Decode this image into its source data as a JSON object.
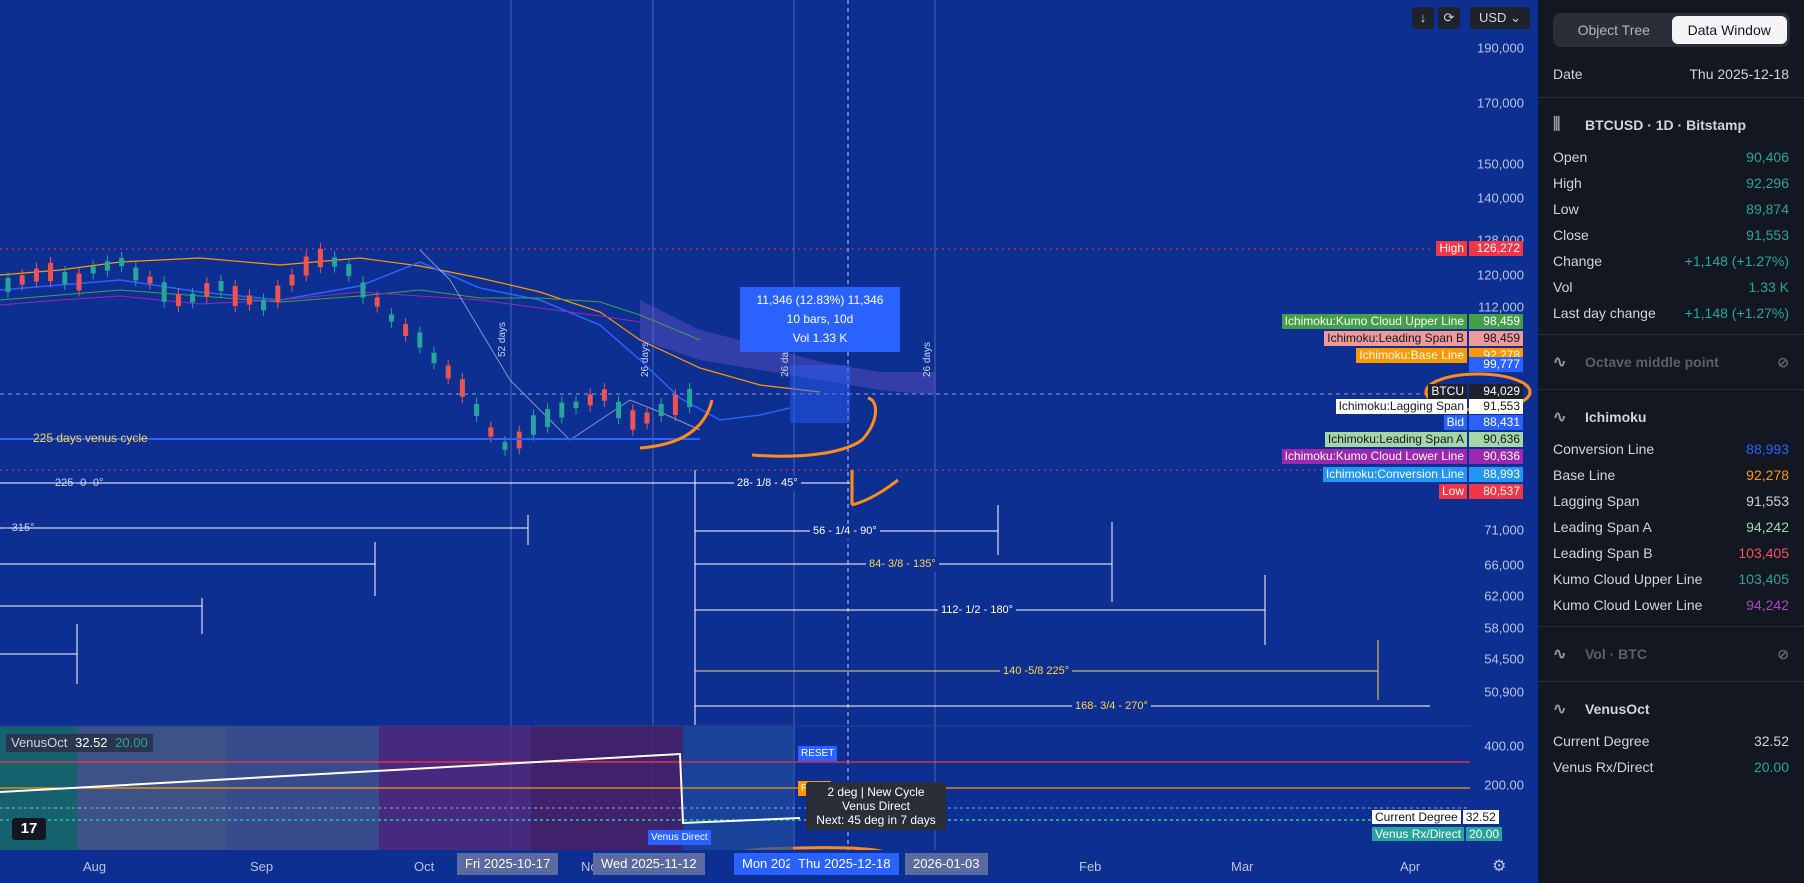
{
  "toolbar": {
    "download_icon": "download-icon",
    "refresh_icon": "refresh-icon",
    "currency": "USD"
  },
  "price_axis": [
    "190,000",
    "170,000",
    "150,000",
    "140,000",
    "128,000",
    "120,000",
    "112,000",
    "71,000",
    "66,000",
    "62,000",
    "58,000",
    "54,500",
    "50,900"
  ],
  "osc_axis": [
    "400.00",
    "200.00"
  ],
  "time_axis": {
    "labels": [
      "Aug",
      "Sep",
      "Oct",
      "No",
      "Feb",
      "Mar",
      "Apr"
    ],
    "highlighted": [
      "Fri 2025-10-17",
      "Wed 2025-11-12",
      "Mon 202",
      "Thu 2025-12-18",
      "2026-01-03"
    ]
  },
  "price_tags": [
    {
      "label": "High",
      "value": "126,272",
      "color": "#f23645"
    },
    {
      "label": "Ichimoku:Kumo Cloud Upper Line",
      "value": "98,459",
      "color": "#43a047"
    },
    {
      "label": "Ichimoku:Leading Span B",
      "value": "98,459",
      "color": "#ef9a9a"
    },
    {
      "label": "Ichimoku:Base Line",
      "value": "92,278",
      "color": "#ff9800"
    },
    {
      "label": "",
      "value": "99,777",
      "color": "#2962ff"
    },
    {
      "label": "BTCU",
      "value": "94,029",
      "color": "#1e222d"
    },
    {
      "label": "Ichimoku:Lagging Span",
      "value": "91,553",
      "color": "#ffffff"
    },
    {
      "label": "Bid",
      "value": "88,431",
      "color": "#2962ff"
    },
    {
      "label": "Ichimoku:Leading Span A",
      "value": "90,636",
      "color": "#a5d6a7"
    },
    {
      "label": "Ichimoku:Kumo Cloud Lower Line",
      "value": "90,636",
      "color": "#9c27b0"
    },
    {
      "label": "Ichimoku:Conversion Line",
      "value": "88,993",
      "color": "#2196f3"
    },
    {
      "label": "Low",
      "value": "80,537",
      "color": "#f23645"
    }
  ],
  "measure_box": {
    "line1": "11,346 (12.83%) 11,346",
    "line2": "10 bars, 10d",
    "line3": "Vol 1.33 K"
  },
  "annotations": {
    "venus_cycle": "225 days venus cycle",
    "venus_arrow": "225- 0- 0°",
    "left_arrow": "- 315°",
    "arrows": [
      "28- 1/8 - 45°",
      "56 - 1/4 - 90°",
      "84- 3/8 - 135°",
      "112- 1/2 - 180°",
      "140 -5/8 225°",
      "168- 3/4 - 270°"
    ],
    "vlines": [
      "52 days",
      "26 days",
      "26 da",
      "26 days"
    ]
  },
  "oscillator": {
    "name": "VenusOct",
    "value1": "32.52",
    "value2": "20.00",
    "reset": "RESET",
    "peak": "PEAK",
    "venus_direct": "Venus Direct",
    "tooltip": [
      "2 deg | New Cycle",
      "Venus Direct",
      "Next: 45 deg in 7 days"
    ],
    "tags": [
      {
        "label": "Current Degree",
        "value": "32.52"
      },
      {
        "label": "Venus Rx/Direct",
        "value": "20.00"
      }
    ]
  },
  "panel": {
    "tabs": [
      "Object Tree",
      "Data Window"
    ],
    "date_label": "Date",
    "date_value": "Thu 2025-12-18",
    "symbol": "BTCUSD · 1D · Bitstamp",
    "ohlc": [
      {
        "label": "Open",
        "value": "90,406",
        "color": "#26a69a"
      },
      {
        "label": "High",
        "value": "92,296",
        "color": "#26a69a"
      },
      {
        "label": "Low",
        "value": "89,874",
        "color": "#26a69a"
      },
      {
        "label": "Close",
        "value": "91,553",
        "color": "#26a69a"
      },
      {
        "label": "Change",
        "value": "+1,148 (+1.27%)",
        "color": "#26a69a"
      },
      {
        "label": "Vol",
        "value": "1.33 K",
        "color": "#26a69a"
      },
      {
        "label": "Last day change",
        "value": "+1,148 (+1.27%)",
        "color": "#26a69a"
      }
    ],
    "octave": "Octave middle point",
    "ichimoku_title": "Ichimoku",
    "ichimoku": [
      {
        "label": "Conversion Line",
        "value": "88,993",
        "color": "#2962ff"
      },
      {
        "label": "Base Line",
        "value": "92,278",
        "color": "#ff9800"
      },
      {
        "label": "Lagging Span",
        "value": "91,553",
        "color": "#d1d4dc"
      },
      {
        "label": "Leading Span A",
        "value": "94,242",
        "color": "#a5d6a7"
      },
      {
        "label": "Leading Span B",
        "value": "103,405",
        "color": "#f7525f"
      },
      {
        "label": "Kumo Cloud Upper Line",
        "value": "103,405",
        "color": "#26a69a"
      },
      {
        "label": "Kumo Cloud Lower Line",
        "value": "94,242",
        "color": "#ab47bc"
      }
    ],
    "vol": "Vol · BTC",
    "venus_title": "VenusOct",
    "venus": [
      {
        "label": "Current Degree",
        "value": "32.52",
        "color": "#d1d4dc"
      },
      {
        "label": "Venus Rx/Direct",
        "value": "20.00",
        "color": "#26a69a"
      }
    ]
  }
}
